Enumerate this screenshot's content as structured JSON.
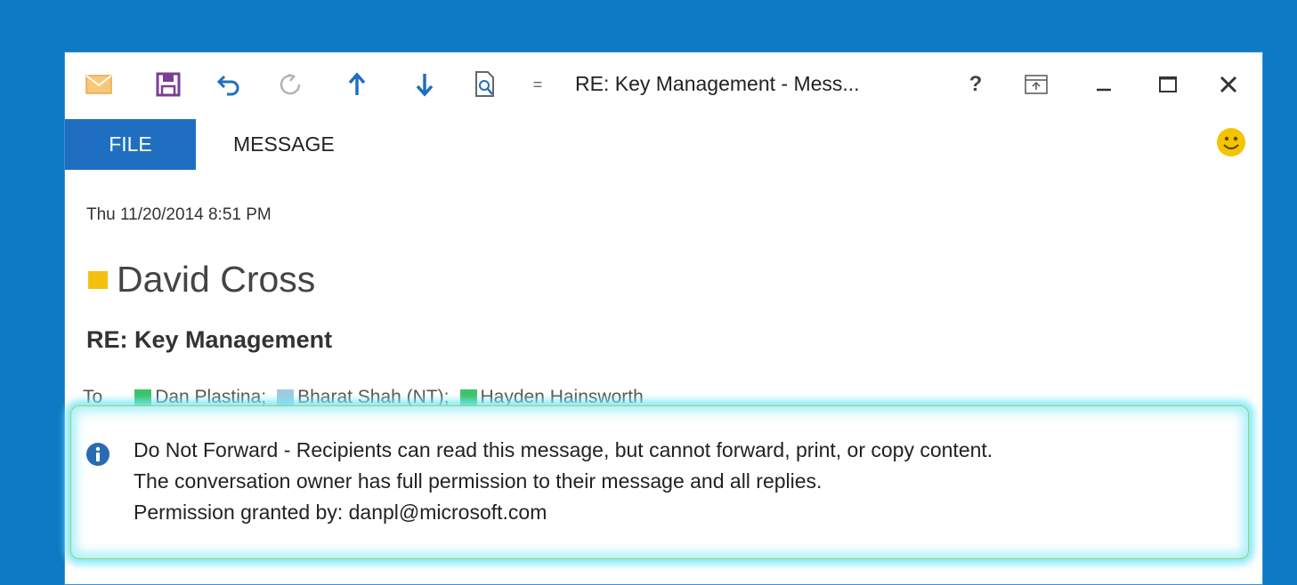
{
  "window": {
    "title": "RE: Key Management - Mess...",
    "help_label": "?",
    "qat_customize_label": "="
  },
  "ribbon": {
    "tabs": [
      {
        "label": "FILE",
        "selected": true
      },
      {
        "label": "MESSAGE",
        "selected": false
      }
    ]
  },
  "message": {
    "date": "Thu 11/20/2014 8:51 PM",
    "sender": "David Cross",
    "subject": "RE: Key Management",
    "to_label": "To",
    "recipients": [
      {
        "name": "Dan Plastina;",
        "status_color": "#3cc46a"
      },
      {
        "name": "Bharat Shah (NT);",
        "status_color": "#9fcbe0"
      },
      {
        "name": "Hayden Hainsworth",
        "status_color": "#3cc46a"
      }
    ]
  },
  "banner": {
    "icon": "info-icon",
    "lines": [
      "Do Not Forward - Recipients can read this message, but cannot forward, print, or copy content.",
      "The conversation owner has full permission to their message and all replies.",
      "Permission granted by: danpl@microsoft.com"
    ]
  },
  "colors": {
    "background": "#0d7ac3",
    "file_tab": "#1e6fc1",
    "sender_presence": "#f3c10d",
    "banner_glow": "#78e6fa"
  }
}
